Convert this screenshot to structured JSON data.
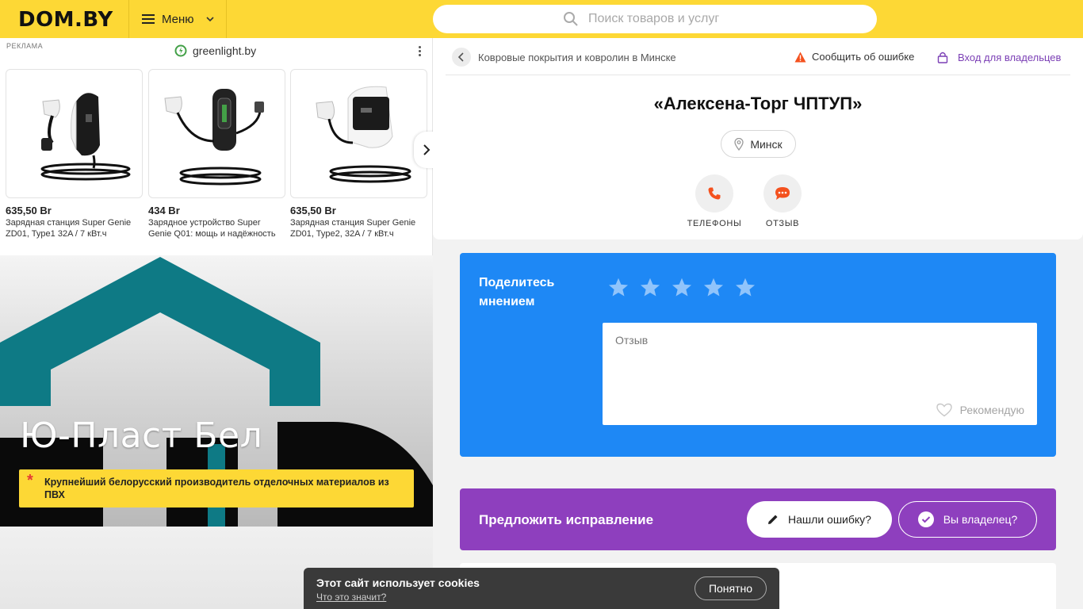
{
  "header": {
    "logo": "DOM.BY",
    "menu_label": "Меню",
    "search_placeholder": "Поиск товаров и услуг"
  },
  "ad": {
    "label": "РЕКЛАМА",
    "brand": "greenlight.by",
    "products": [
      {
        "price": "635,50 Br",
        "desc": "Зарядная станция Super Genie ZD01, Type1 32A / 7 кВт.ч"
      },
      {
        "price": "434 Br",
        "desc": "Зарядное устройство Super Genie Q01: мощь и надёжность"
      },
      {
        "price": "635,50 Br",
        "desc": "Зарядная станция Super Genie ZD01, Type2, 32A / 7 кВт.ч"
      }
    ]
  },
  "banner": {
    "title": "Ю-Пласт Бел",
    "note_mark": "*",
    "note": "Крупнейший белорусский производитель отделочных материалов из ПВХ"
  },
  "company": {
    "breadcrumb": "Ковровые покрытия и ковролин в Минске",
    "report_label": "Сообщить об ошибке",
    "owner_login": "Вход для владельцев",
    "title": "«Алексена-Торг ЧПТУП»",
    "city": "Минск",
    "actions": {
      "phones": "ТЕЛЕФОНЫ",
      "review": "ОТЗЫВ"
    }
  },
  "review": {
    "title": "Поделитесь мнением",
    "placeholder": "Отзыв",
    "recommend": "Рекомендую"
  },
  "suggest": {
    "title": "Предложить исправление",
    "found_error": "Нашли ошибку?",
    "are_owner": "Вы владелец?"
  },
  "cookie": {
    "text": "Этот сайт использует cookies",
    "link": "Что это значит?",
    "button": "Понятно"
  },
  "colors": {
    "header": "#fdd835",
    "review_bg": "#1e88f5",
    "suggest_bg": "#8e3fbe",
    "phone_accent": "#f4511e",
    "owner_link": "#7b3fb5"
  }
}
